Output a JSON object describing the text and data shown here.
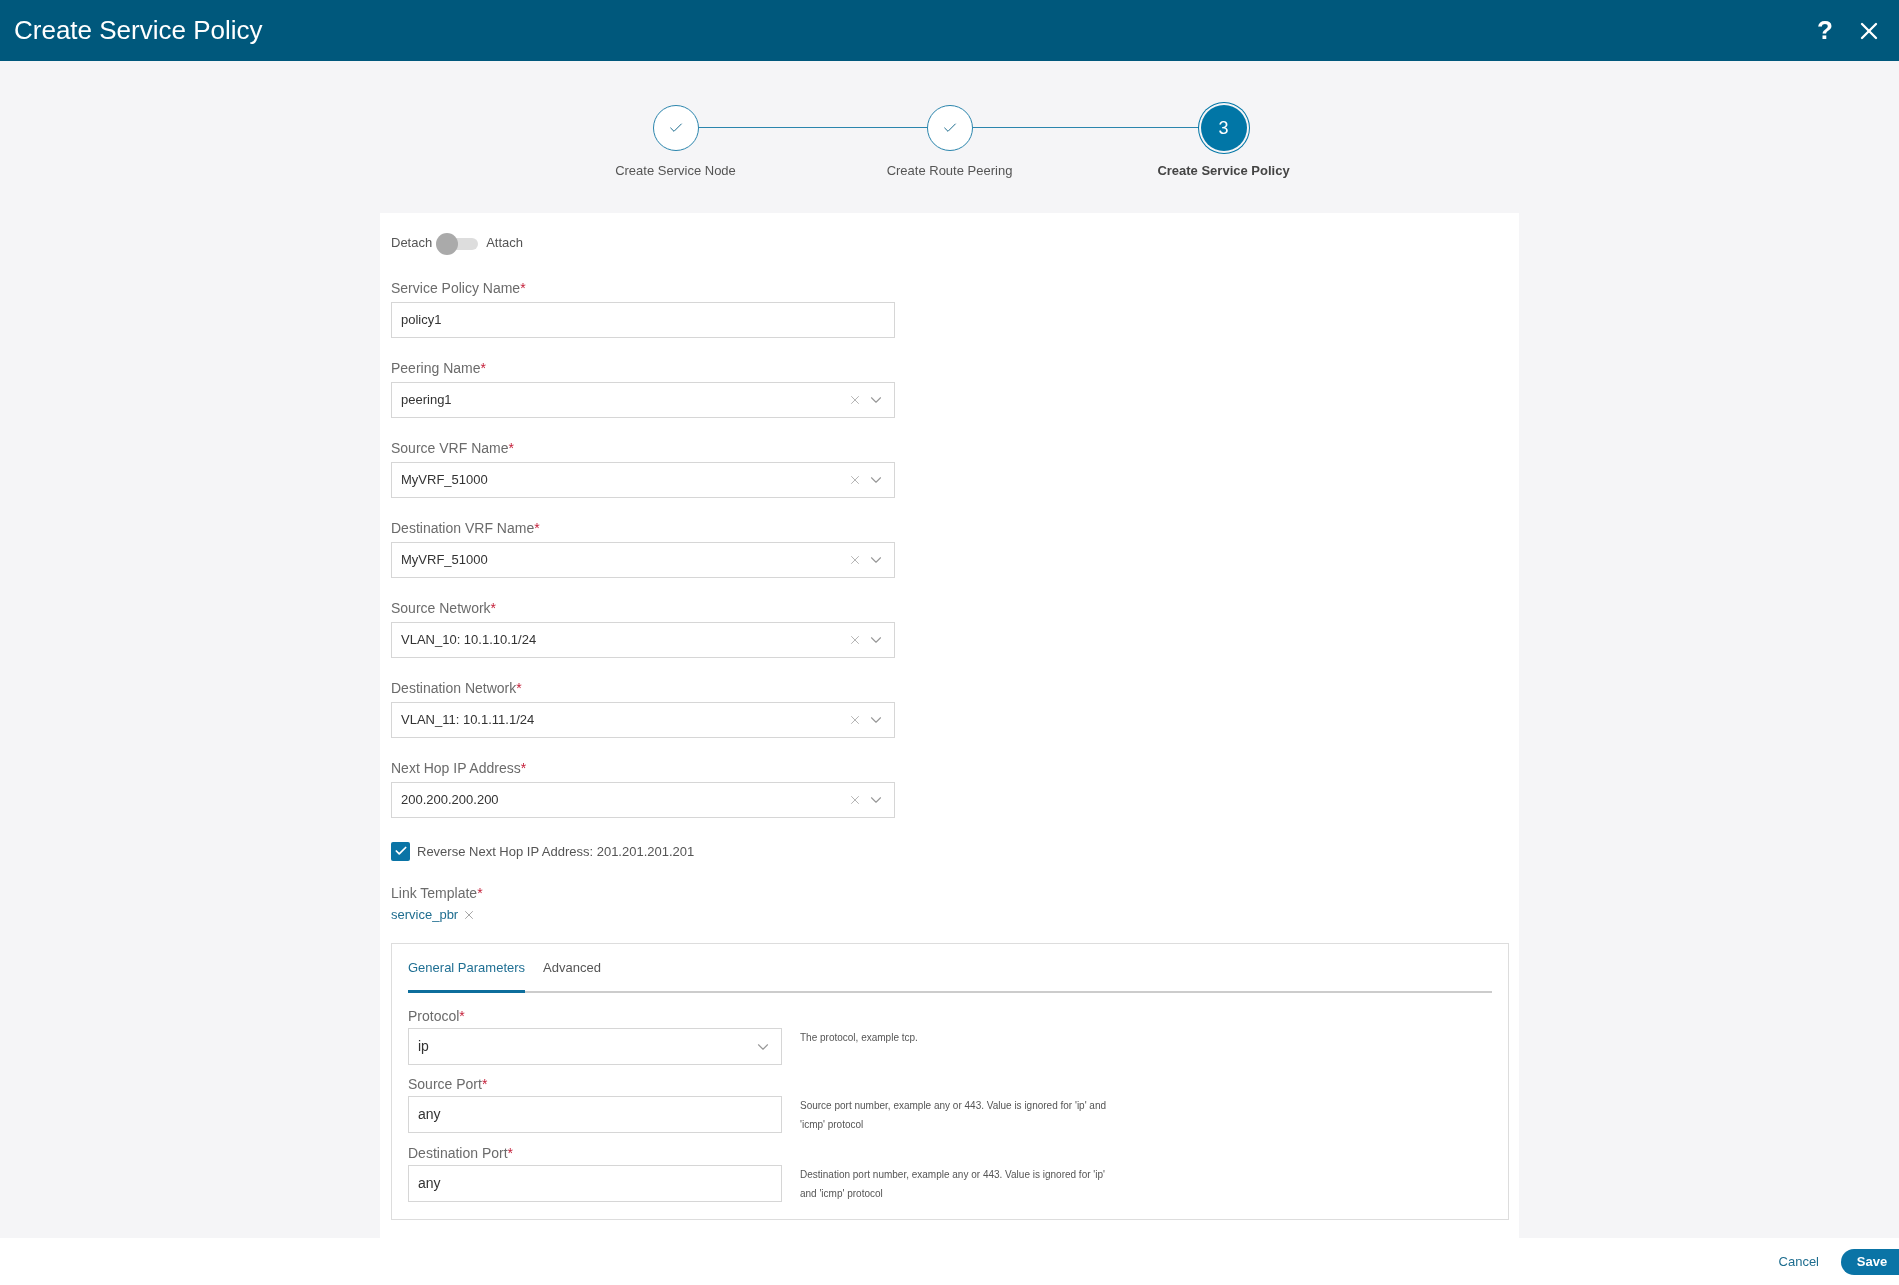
{
  "header": {
    "title": "Create Service Policy",
    "help": "?"
  },
  "steps": [
    {
      "label": "Create Service Node",
      "done": true
    },
    {
      "label": "Create Route Peering",
      "done": true
    },
    {
      "label": "Create Service Policy",
      "done": false,
      "number": "3"
    }
  ],
  "toggle": {
    "left_label": "Detach",
    "right_label": "Attach",
    "on": false
  },
  "fields": [
    {
      "kind": "text",
      "label": "Service Policy Name",
      "required_mark": "*",
      "value": "policy1"
    },
    {
      "kind": "select",
      "label": "Peering Name",
      "required_mark": "*",
      "value": "peering1"
    },
    {
      "kind": "select",
      "label": "Source VRF Name",
      "required_mark": "*",
      "value": "MyVRF_51000"
    },
    {
      "kind": "select",
      "label": "Destination VRF Name",
      "required_mark": "*",
      "value": "MyVRF_51000"
    },
    {
      "kind": "select",
      "label": "Source Network",
      "required_mark": "*",
      "value": "VLAN_10: 10.1.10.1/24"
    },
    {
      "kind": "select",
      "label": "Destination Network",
      "required_mark": "*",
      "value": "VLAN_11: 10.1.11.1/24"
    },
    {
      "kind": "select",
      "label": "Next Hop IP Address",
      "required_mark": "*",
      "value": "200.200.200.200"
    }
  ],
  "reverse_checkbox": {
    "label": "Reverse Next Hop IP Address: 201.201.201.201",
    "checked": true
  },
  "link_template": {
    "label": "Link Template",
    "required_mark": "*",
    "value": "service_pbr"
  },
  "panel": {
    "tabs": [
      {
        "label": "General Parameters",
        "selected": true
      },
      {
        "label": "Advanced",
        "selected": false
      }
    ],
    "params": [
      {
        "kind": "select",
        "label": "Protocol",
        "required_mark": "*",
        "value": "ip",
        "help": "The protocol, example tcp."
      },
      {
        "kind": "text",
        "label": "Source Port",
        "required_mark": "*",
        "value": "any",
        "help": "Source port number, example any or 443. Value is ignored for 'ip' and 'icmp' protocol"
      },
      {
        "kind": "text",
        "label": "Destination Port",
        "required_mark": "*",
        "value": "any",
        "help": "Destination port number, example any or 443. Value is ignored for 'ip' and 'icmp' protocol"
      }
    ]
  },
  "footer": {
    "cancel": "Cancel",
    "save": "Save"
  }
}
